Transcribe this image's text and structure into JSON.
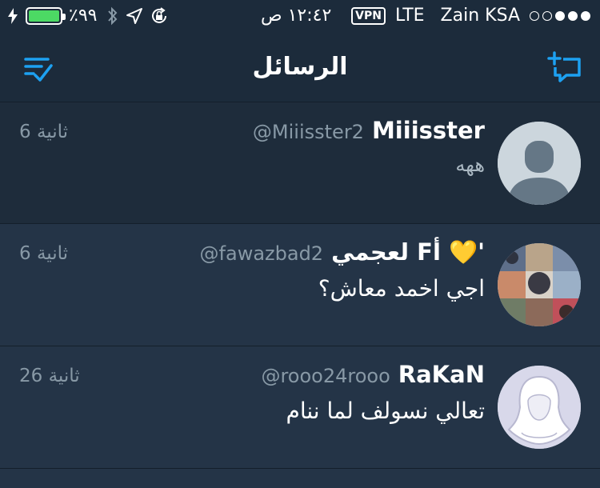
{
  "status_bar": {
    "battery_percent": "٪٩٩",
    "battery_level": 0.99,
    "time": "١٢:٤٢ ص",
    "vpn": "VPN",
    "network": "LTE",
    "carrier": "Zain KSA",
    "signal_bars_filled": 3,
    "signal_bars_total": 5,
    "icons": [
      "charging-bolt-icon",
      "battery-icon",
      "bluetooth-icon",
      "location-arrow-icon",
      "rotation-lock-icon"
    ]
  },
  "nav": {
    "title": "الرسائل",
    "left_icon": "mark-all-read-icon",
    "right_icon": "new-message-icon",
    "accent_color": "#1da1f2"
  },
  "conversations": [
    {
      "name": "Miiisster",
      "handle": "@Miiisster2",
      "time": "6 ثانية",
      "message": "ههه",
      "avatar": "default-avatar"
    },
    {
      "name_prefix": "'",
      "name_heart": "💛",
      "name": "أF لعجمي",
      "handle": "@fawazbad2",
      "time": "6 ثانية",
      "message": "اجي اخمد معاش؟",
      "avatar": "collage-avatar"
    },
    {
      "name": "RaKaN",
      "handle": "@rooo24rooo",
      "time": "26 ثانية",
      "message": "تعالي نسولف لما ننام",
      "avatar": "hooded-figure-avatar"
    }
  ],
  "colors": {
    "background": "#243447",
    "bar_background": "#1c2b3b",
    "secondary_text": "#8899a6",
    "battery_green": "#4cd964",
    "accent": "#1da1f2"
  }
}
